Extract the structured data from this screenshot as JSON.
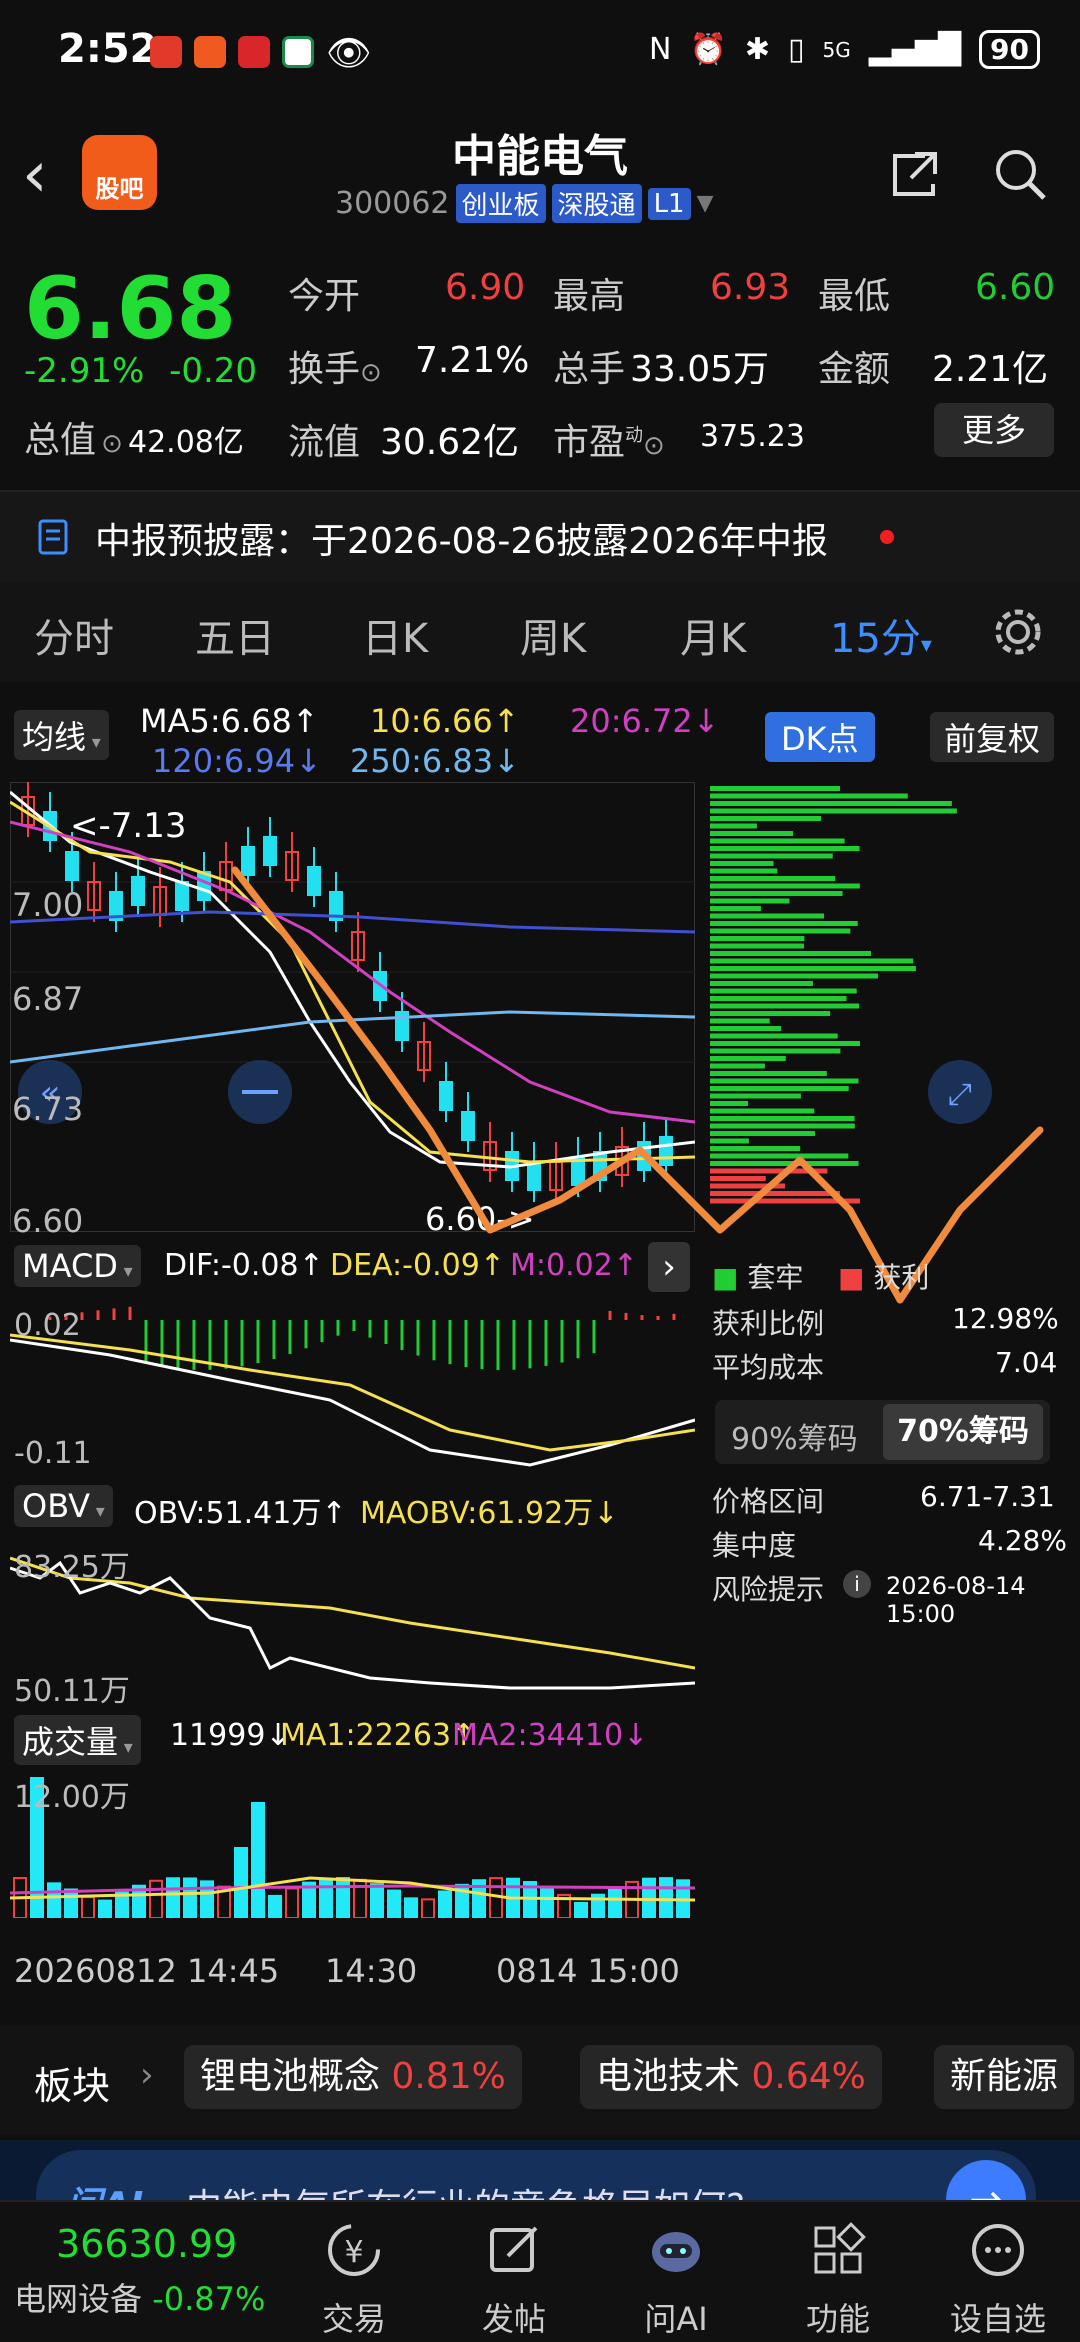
{
  "status_bar": {
    "time": "2:52",
    "network": "5G",
    "battery": "90"
  },
  "header": {
    "title": "中能电气",
    "code": "300062",
    "tags": [
      "创业板",
      "深股通",
      "L1"
    ],
    "logo_text": "股吧"
  },
  "quote": {
    "price": "6.68",
    "change_pct": "-2.91%",
    "change_abs": "-0.20",
    "open_label": "今开",
    "open": "6.90",
    "high_label": "最高",
    "high": "6.93",
    "low_label": "最低",
    "low": "6.60",
    "turnover_label": "换手",
    "turnover": "7.21%",
    "volume_label": "总手",
    "volume": "33.05万",
    "amount_label": "金额",
    "amount": "2.21亿",
    "total_mv_label": "总值",
    "total_mv": "42.08亿",
    "float_mv_label": "流值",
    "float_mv": "30.62亿",
    "pe_label": "市盈",
    "pe_sup": "动",
    "pe": "375.23",
    "more": "更多"
  },
  "notice": {
    "text": "中报预披露：于2026-08-26披露2026年中报"
  },
  "tabs": [
    "分时",
    "五日",
    "日K",
    "周K",
    "月K",
    "15分"
  ],
  "chart": {
    "ma_label": "均线",
    "ma5": "MA5:6.68↑",
    "ma10": "10:6.66↑",
    "ma20": "20:6.72↓",
    "ma120": "120:6.94↓",
    "ma250": "250:6.83↓",
    "dk_btn": "DK点",
    "fq_btn": "前复权",
    "y_ticks": [
      "7.00",
      "6.87",
      "6.73",
      "6.60"
    ],
    "high_mark": "7.13",
    "low_mark": "6.60",
    "macd_label": "MACD",
    "dif": "DIF:-0.08↑",
    "dea": "DEA:-0.09↑",
    "m": "M:0.02↑",
    "macd_ticks": [
      "0.02",
      "-0.11"
    ],
    "obv_label": "OBV",
    "obv": "OBV:51.41万↑",
    "maobv": "MAOBV:61.92万↓",
    "obv_ticks": [
      "83.25万",
      "50.11万"
    ],
    "vol_label": "成交量",
    "vol": "11999↓",
    "vma1": "MA1:22263↑",
    "vma2": "MA2:34410↓",
    "vol_tick": "12.00万",
    "x_left": "20260812 14:45",
    "x_mid": "14:30",
    "x_right": "0814 15:00",
    "chip_legend_trap": "套牢",
    "chip_legend_profit": "获利",
    "profit_ratio_label": "获利比例",
    "profit_ratio": "12.98%",
    "avg_cost_label": "平均成本",
    "avg_cost": "7.04",
    "chip90": "90%筹码",
    "chip70": "70%筹码",
    "range_label": "价格区间",
    "range": "6.71-7.31",
    "conc_label": "集中度",
    "conc": "4.28%",
    "risk_label": "风险提示",
    "risk_time": "2026-08-14 15:00"
  },
  "sector": {
    "label": "板块",
    "items": [
      {
        "name": "锂电池概念",
        "pct": "0.81%"
      },
      {
        "name": "电池技术",
        "pct": "0.64%"
      },
      {
        "name": "新能源",
        "pct": ""
      }
    ]
  },
  "ai_banner": {
    "brand": "问AI",
    "text": "中能电气所在行业的竞争格局如何?"
  },
  "bottom_nav": {
    "index_value": "36630.99",
    "index_name": "电网设备",
    "index_pct": "-0.87%",
    "items": [
      "交易",
      "发帖",
      "问AI",
      "功能",
      "设自选"
    ]
  },
  "colors": {
    "up": "#f04040",
    "down": "#22cc33",
    "accent": "#3d8fff",
    "orange_annotation": "#f08a3c"
  }
}
